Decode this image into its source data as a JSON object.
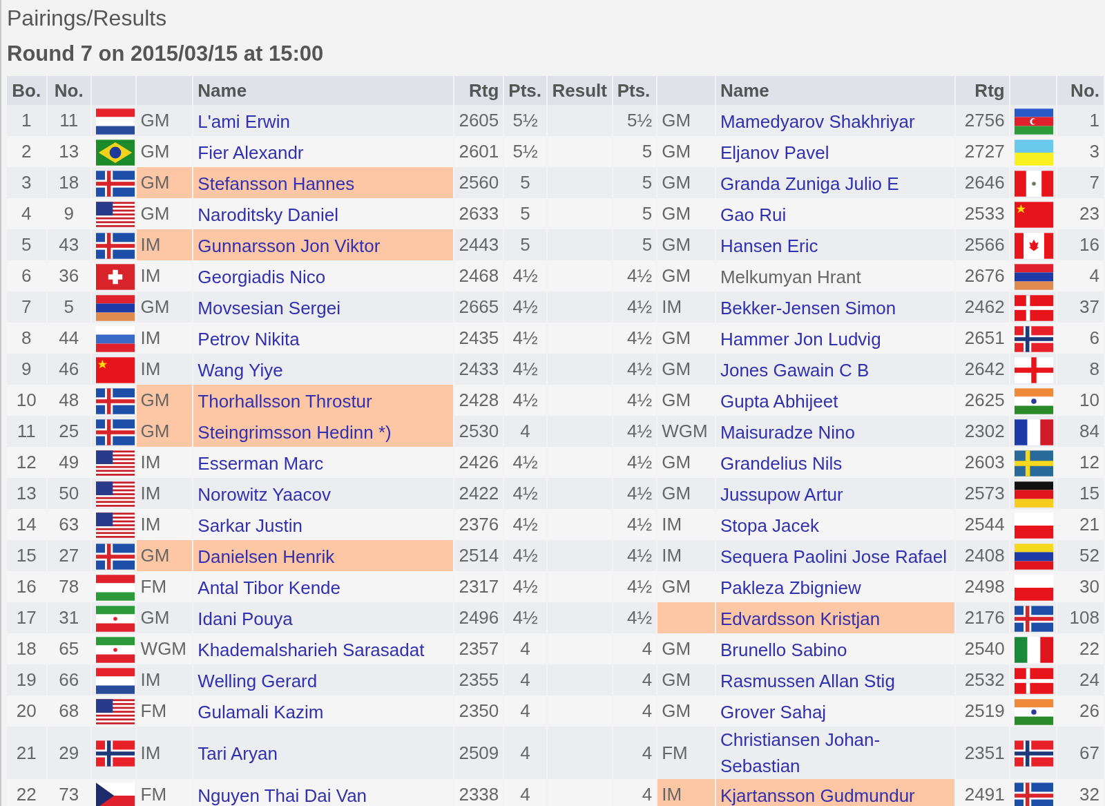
{
  "title": "Pairings/Results",
  "subtitle": "Round 7 on 2015/03/15 at 15:00",
  "columns": [
    "Bo.",
    "No.",
    "",
    "",
    "Name",
    "Rtg",
    "Pts.",
    "Result",
    "Pts.",
    "",
    "Name",
    "Rtg",
    "",
    "No."
  ],
  "rows": [
    {
      "board": "1",
      "white": {
        "no": "11",
        "kind": "nl",
        "title": "GM",
        "name": "L'ami Erwin",
        "rating": "2605",
        "points": "5½",
        "highlighted": false,
        "linked": true
      },
      "black": {
        "no": "1",
        "kind": "az",
        "title": "GM",
        "name": "Mamedyarov Shakhriyar",
        "rating": "2756",
        "points": "5½",
        "highlighted": false,
        "linked": true
      }
    },
    {
      "board": "2",
      "white": {
        "no": "13",
        "kind": "br",
        "title": "GM",
        "name": "Fier Alexandr",
        "rating": "2601",
        "points": "5½",
        "highlighted": false,
        "linked": true
      },
      "black": {
        "no": "3",
        "kind": "ua",
        "title": "GM",
        "name": "Eljanov Pavel",
        "rating": "2727",
        "points": "5",
        "highlighted": false,
        "linked": true
      }
    },
    {
      "board": "3",
      "white": {
        "no": "18",
        "kind": "is",
        "title": "GM",
        "name": "Stefansson Hannes",
        "rating": "2560",
        "points": "5",
        "highlighted": true,
        "linked": true
      },
      "black": {
        "no": "7",
        "kind": "pe",
        "title": "GM",
        "name": "Granda Zuniga Julio E",
        "rating": "2646",
        "points": "5",
        "highlighted": false,
        "linked": true
      }
    },
    {
      "board": "4",
      "white": {
        "no": "9",
        "kind": "us",
        "title": "GM",
        "name": "Naroditsky Daniel",
        "rating": "2633",
        "points": "5",
        "highlighted": false,
        "linked": true
      },
      "black": {
        "no": "23",
        "kind": "cn",
        "title": "GM",
        "name": "Gao Rui",
        "rating": "2533",
        "points": "5",
        "highlighted": false,
        "linked": true
      }
    },
    {
      "board": "5",
      "white": {
        "no": "43",
        "kind": "is",
        "title": "IM",
        "name": "Gunnarsson Jon Viktor",
        "rating": "2443",
        "points": "5",
        "highlighted": true,
        "linked": true
      },
      "black": {
        "no": "16",
        "kind": "ca",
        "title": "GM",
        "name": "Hansen Eric",
        "rating": "2566",
        "points": "5",
        "highlighted": false,
        "linked": true
      }
    },
    {
      "board": "6",
      "white": {
        "no": "36",
        "kind": "ch",
        "title": "IM",
        "name": "Georgiadis Nico",
        "rating": "2468",
        "points": "4½",
        "highlighted": false,
        "linked": true
      },
      "black": {
        "no": "4",
        "kind": "am",
        "title": "GM",
        "name": "Melkumyan Hrant",
        "rating": "2676",
        "points": "4½",
        "highlighted": false,
        "linked": false
      }
    },
    {
      "board": "7",
      "white": {
        "no": "5",
        "kind": "am",
        "title": "GM",
        "name": "Movsesian Sergei",
        "rating": "2665",
        "points": "4½",
        "highlighted": false,
        "linked": true
      },
      "black": {
        "no": "37",
        "kind": "dk",
        "title": "IM",
        "name": "Bekker-Jensen Simon",
        "rating": "2462",
        "points": "4½",
        "highlighted": false,
        "linked": true
      }
    },
    {
      "board": "8",
      "white": {
        "no": "44",
        "kind": "ru",
        "title": "IM",
        "name": "Petrov Nikita",
        "rating": "2435",
        "points": "4½",
        "highlighted": false,
        "linked": true
      },
      "black": {
        "no": "6",
        "kind": "no",
        "title": "GM",
        "name": "Hammer Jon Ludvig",
        "rating": "2651",
        "points": "4½",
        "highlighted": false,
        "linked": true
      }
    },
    {
      "board": "9",
      "white": {
        "no": "46",
        "kind": "cn",
        "title": "IM",
        "name": "Wang Yiye",
        "rating": "2433",
        "points": "4½",
        "highlighted": false,
        "linked": true
      },
      "black": {
        "no": "8",
        "kind": "en",
        "title": "GM",
        "name": "Jones Gawain C B",
        "rating": "2642",
        "points": "4½",
        "highlighted": false,
        "linked": true
      }
    },
    {
      "board": "10",
      "white": {
        "no": "48",
        "kind": "is",
        "title": "GM",
        "name": "Thorhallsson Throstur",
        "rating": "2428",
        "points": "4½",
        "highlighted": true,
        "linked": true
      },
      "black": {
        "no": "10",
        "kind": "in",
        "title": "GM",
        "name": "Gupta Abhijeet",
        "rating": "2625",
        "points": "4½",
        "highlighted": false,
        "linked": true
      }
    },
    {
      "board": "11",
      "white": {
        "no": "25",
        "kind": "is",
        "title": "GM",
        "name": "Steingrimsson Hedinn *)",
        "rating": "2530",
        "points": "4",
        "highlighted": true,
        "linked": true
      },
      "black": {
        "no": "84",
        "kind": "fr",
        "title": "WGM",
        "name": "Maisuradze Nino",
        "rating": "2302",
        "points": "4½",
        "highlighted": false,
        "linked": true
      }
    },
    {
      "board": "12",
      "white": {
        "no": "49",
        "kind": "us",
        "title": "IM",
        "name": "Esserman Marc",
        "rating": "2426",
        "points": "4½",
        "highlighted": false,
        "linked": true
      },
      "black": {
        "no": "12",
        "kind": "se",
        "title": "GM",
        "name": "Grandelius Nils",
        "rating": "2603",
        "points": "4½",
        "highlighted": false,
        "linked": true
      }
    },
    {
      "board": "13",
      "white": {
        "no": "50",
        "kind": "us",
        "title": "IM",
        "name": "Norowitz Yaacov",
        "rating": "2422",
        "points": "4½",
        "highlighted": false,
        "linked": true
      },
      "black": {
        "no": "15",
        "kind": "de",
        "title": "GM",
        "name": "Jussupow Artur",
        "rating": "2573",
        "points": "4½",
        "highlighted": false,
        "linked": true
      }
    },
    {
      "board": "14",
      "white": {
        "no": "63",
        "kind": "us",
        "title": "IM",
        "name": "Sarkar Justin",
        "rating": "2376",
        "points": "4½",
        "highlighted": false,
        "linked": true
      },
      "black": {
        "no": "21",
        "kind": "pl",
        "title": "IM",
        "name": "Stopa Jacek",
        "rating": "2544",
        "points": "4½",
        "highlighted": false,
        "linked": true
      }
    },
    {
      "board": "15",
      "white": {
        "no": "27",
        "kind": "is",
        "title": "GM",
        "name": "Danielsen Henrik",
        "rating": "2514",
        "points": "4½",
        "highlighted": true,
        "linked": true
      },
      "black": {
        "no": "52",
        "kind": "ve",
        "title": "IM",
        "name": "Sequera Paolini Jose Rafael",
        "rating": "2408",
        "points": "4½",
        "highlighted": false,
        "linked": true
      }
    },
    {
      "board": "16",
      "white": {
        "no": "78",
        "kind": "hu",
        "title": "FM",
        "name": "Antal Tibor Kende",
        "rating": "2317",
        "points": "4½",
        "highlighted": false,
        "linked": true
      },
      "black": {
        "no": "30",
        "kind": "pl",
        "title": "GM",
        "name": "Pakleza Zbigniew",
        "rating": "2498",
        "points": "4½",
        "highlighted": false,
        "linked": true
      }
    },
    {
      "board": "17",
      "white": {
        "no": "31",
        "kind": "ir",
        "title": "GM",
        "name": "Idani Pouya",
        "rating": "2496",
        "points": "4½",
        "highlighted": false,
        "linked": true
      },
      "black": {
        "no": "108",
        "kind": "is",
        "name": "Edvardsson Kristjan",
        "rating": "2176",
        "points": "4½",
        "highlighted": true,
        "linked": true
      }
    },
    {
      "board": "18",
      "white": {
        "no": "65",
        "kind": "ir",
        "title": "WGM",
        "name": "Khademalsharieh Sarasadat",
        "rating": "2357",
        "points": "4",
        "highlighted": false,
        "linked": true
      },
      "black": {
        "no": "22",
        "kind": "it",
        "title": "GM",
        "name": "Brunello Sabino",
        "rating": "2540",
        "points": "4",
        "highlighted": false,
        "linked": true
      }
    },
    {
      "board": "19",
      "white": {
        "no": "66",
        "kind": "nl",
        "title": "IM",
        "name": "Welling Gerard",
        "rating": "2355",
        "points": "4",
        "highlighted": false,
        "linked": true
      },
      "black": {
        "no": "24",
        "kind": "dk",
        "title": "GM",
        "name": "Rasmussen Allan Stig",
        "rating": "2532",
        "points": "4",
        "highlighted": false,
        "linked": true
      }
    },
    {
      "board": "20",
      "white": {
        "no": "68",
        "kind": "us",
        "title": "FM",
        "name": "Gulamali Kazim",
        "rating": "2350",
        "points": "4",
        "highlighted": false,
        "linked": true
      },
      "black": {
        "no": "26",
        "kind": "in",
        "title": "GM",
        "name": "Grover Sahaj",
        "rating": "2519",
        "points": "4",
        "highlighted": false,
        "linked": true
      }
    },
    {
      "board": "21",
      "white": {
        "no": "29",
        "kind": "no",
        "title": "IM",
        "name": "Tari Aryan",
        "rating": "2509",
        "points": "4",
        "highlighted": false,
        "linked": true
      },
      "black": {
        "no": "67",
        "kind": "no",
        "title": "FM",
        "name": "Christiansen Johan-Sebastian",
        "rating": "2351",
        "points": "4",
        "highlighted": false,
        "linked": true
      }
    },
    {
      "board": "22",
      "white": {
        "no": "73",
        "kind": "cz",
        "title": "FM",
        "name": "Nguyen Thai Dai Van",
        "rating": "2338",
        "points": "4",
        "highlighted": false,
        "linked": true
      },
      "black": {
        "no": "32",
        "kind": "is",
        "title": "IM",
        "name": "Kjartansson Gudmundur",
        "rating": "2491",
        "points": "4",
        "highlighted": true,
        "linked": true
      }
    }
  ]
}
